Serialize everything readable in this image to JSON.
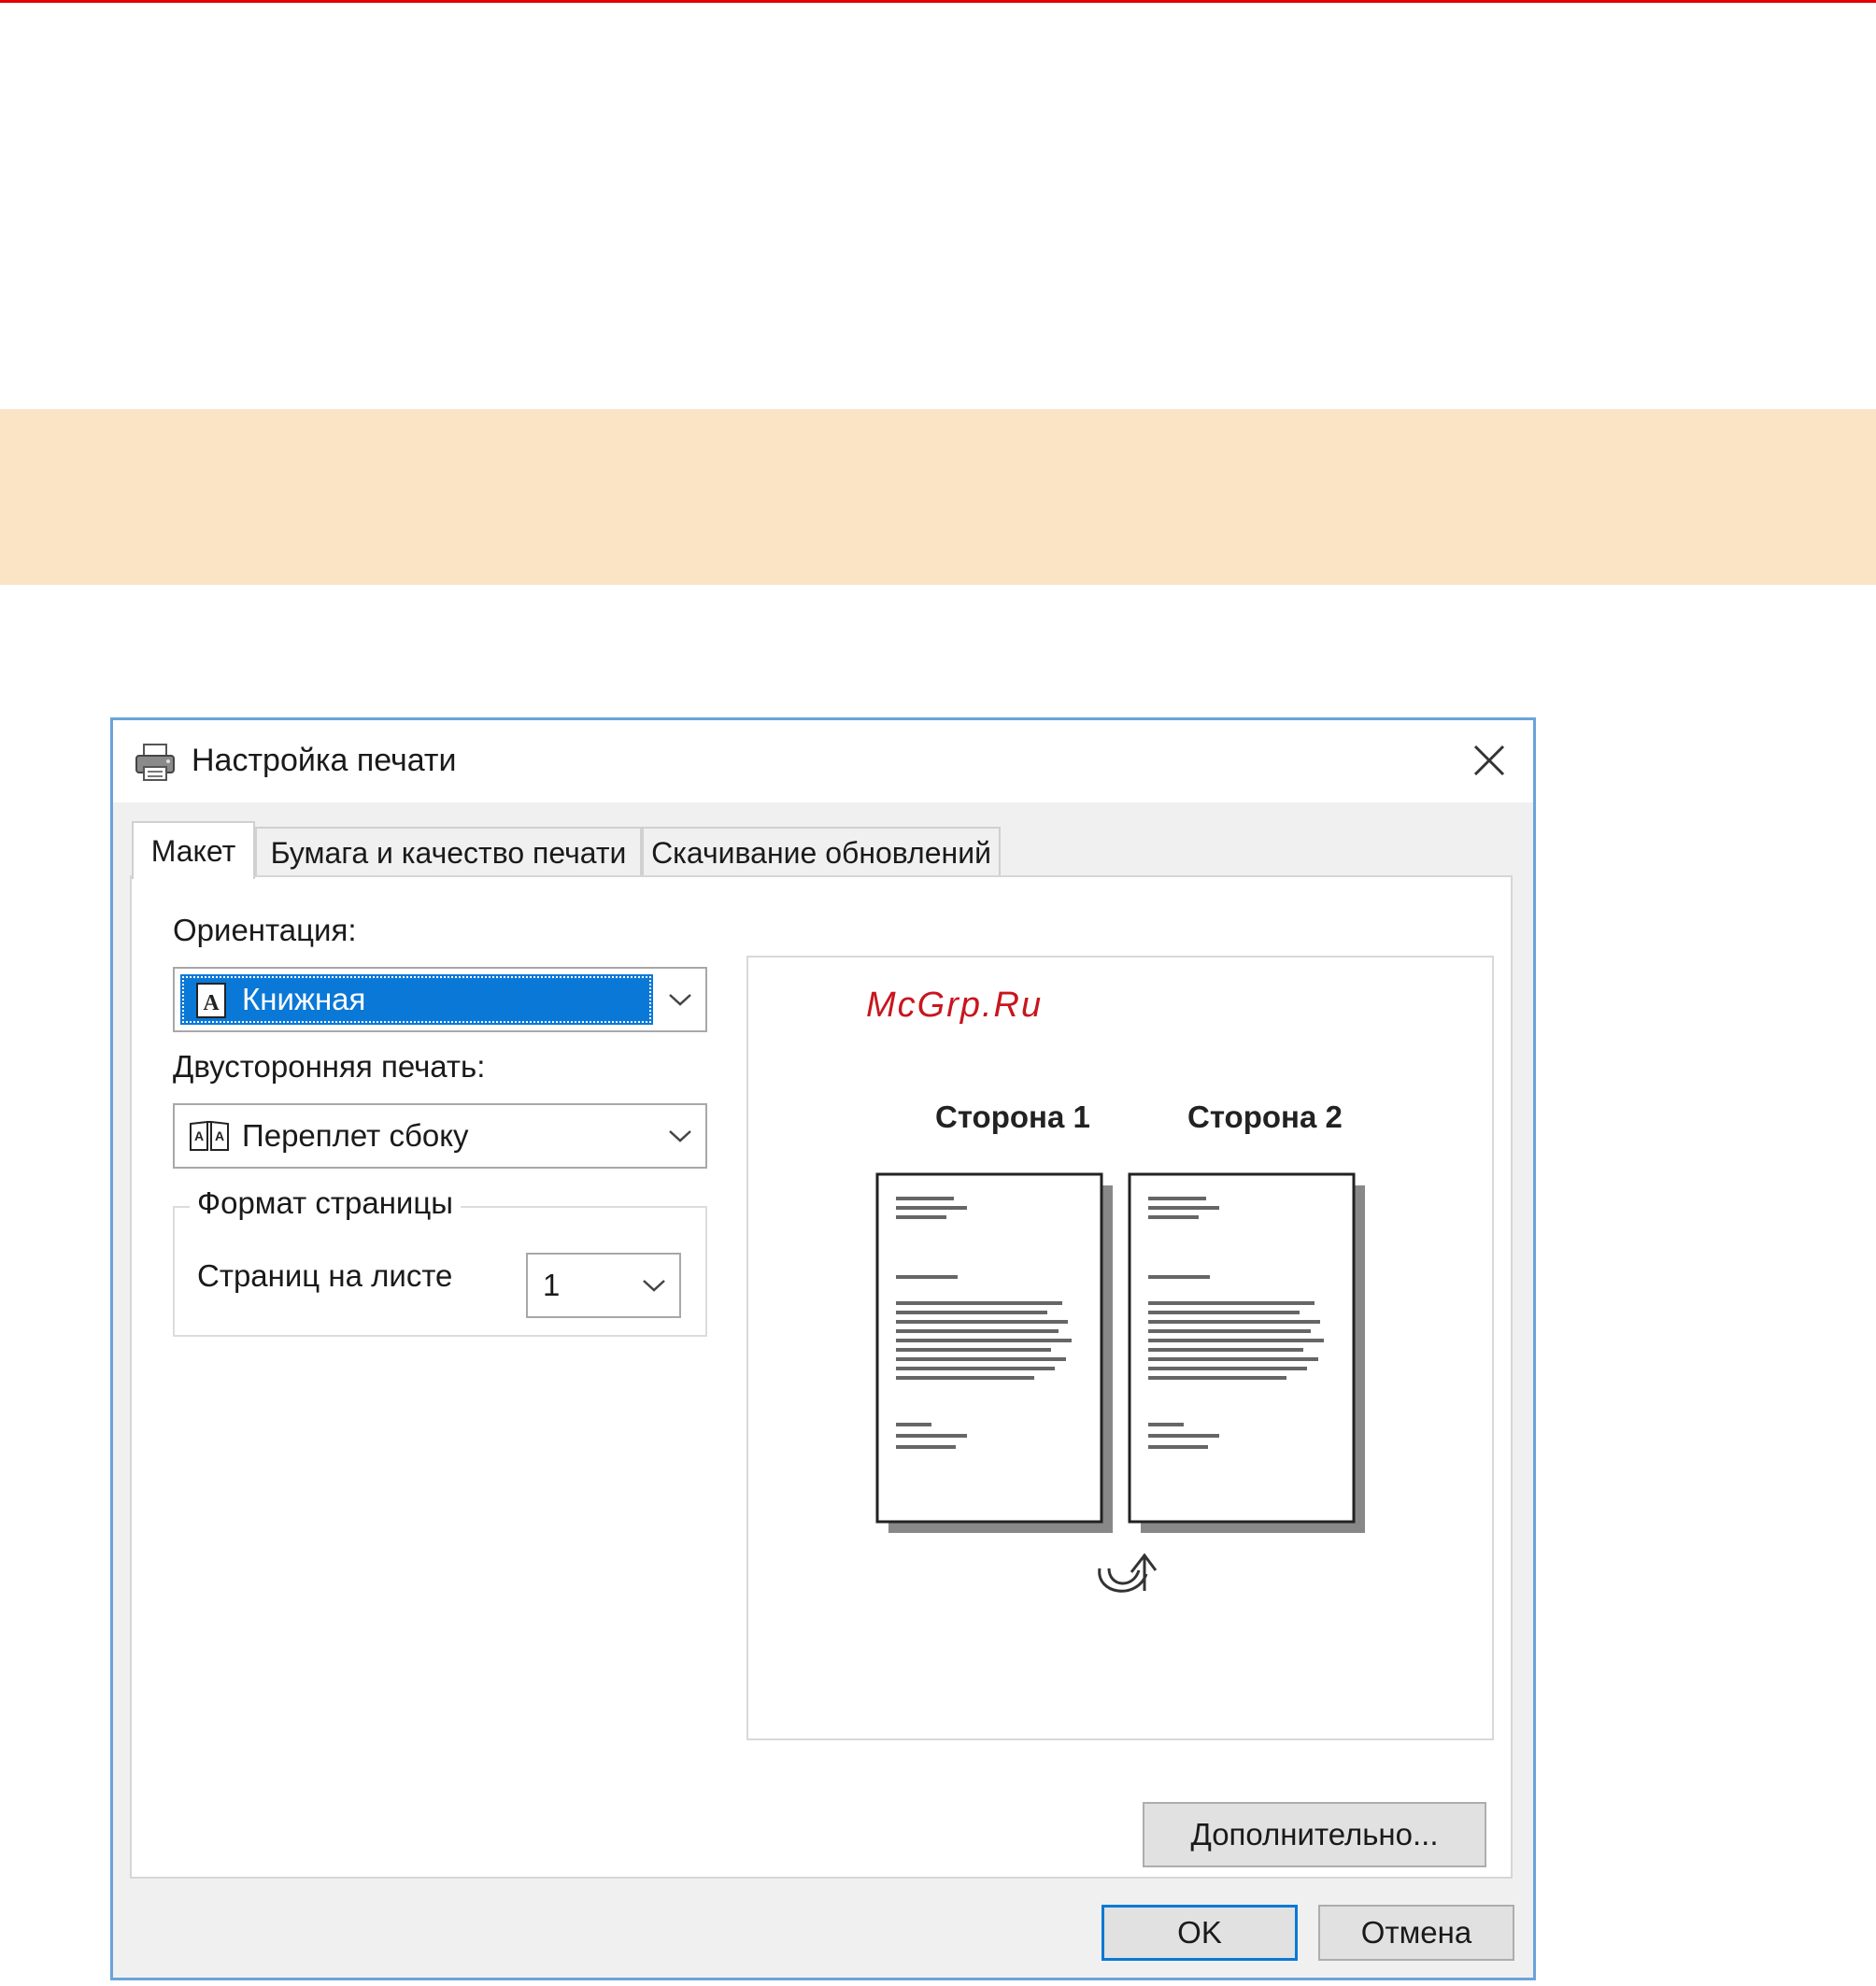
{
  "dialog": {
    "title": "Настройка печати",
    "close_icon": "close-icon",
    "tabs": [
      {
        "label": "Макет",
        "active": true
      },
      {
        "label": "Бумага и качество печати",
        "active": false
      },
      {
        "label": "Скачивание обновлений",
        "active": false
      }
    ],
    "orientation": {
      "label": "Ориентация:",
      "value": "Книжная",
      "icon": "portrait-page-icon"
    },
    "duplex": {
      "label": "Двусторонняя печать:",
      "value": "Переплет сбоку",
      "icon": "book-icon"
    },
    "page_format": {
      "group_title": "Формат страницы",
      "pages_per_sheet_label": "Страниц на листе",
      "pages_per_sheet_value": "1"
    },
    "preview": {
      "watermark": "McGrp.Ru",
      "side1_label": "Сторона 1",
      "side2_label": "Сторона 2",
      "flip_icon": "flip-arrow-icon"
    },
    "advanced_button": "Дополнительно...",
    "ok_button": "OK",
    "cancel_button": "Отмена"
  },
  "colors": {
    "banner": "#fbe3c5",
    "top_line": "#e00000",
    "selection": "#0a78d7",
    "watermark": "#c8161e"
  }
}
